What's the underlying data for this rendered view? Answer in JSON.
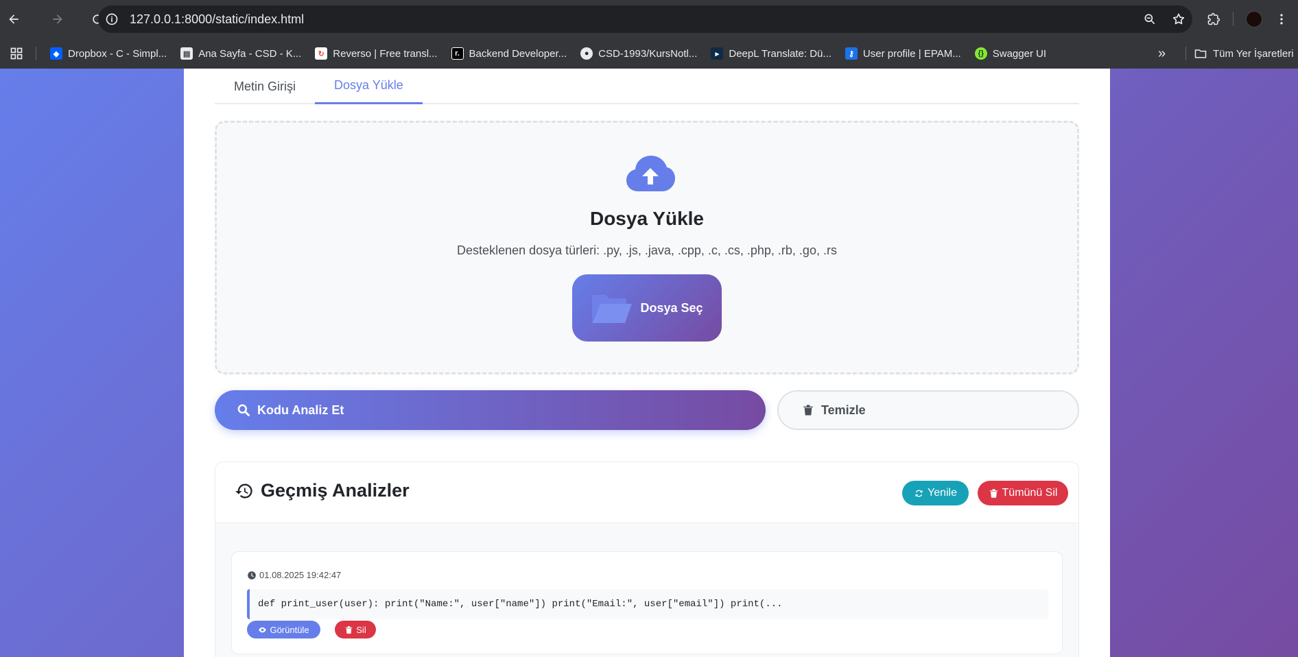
{
  "browser": {
    "url": "127.0.0.1:8000/static/index.html",
    "bookmarks": [
      {
        "label": "Dropbox - C - Simpl...",
        "icon": "dropbox-icon",
        "color": "#0061fe"
      },
      {
        "label": "Ana Sayfa - CSD - K...",
        "icon": "document-icon",
        "color": "#ffffff"
      },
      {
        "label": "Reverso | Free transl...",
        "icon": "reverso-icon",
        "color": "#e94f35"
      },
      {
        "label": "Backend Developer...",
        "icon": "roadmap-icon",
        "color": "#000000"
      },
      {
        "label": "CSD-1993/KursNotl...",
        "icon": "github-icon",
        "color": "#ffffff"
      },
      {
        "label": "DeepL Translate: Dü...",
        "icon": "deepl-icon",
        "color": "#0f2b46"
      },
      {
        "label": "User profile | EPAM...",
        "icon": "key-icon",
        "color": "#1a73e8"
      },
      {
        "label": "Swagger UI",
        "icon": "swagger-icon",
        "color": "#85ea2d"
      }
    ],
    "all_bookmarks_label": "Tüm Yer İşaretleri"
  },
  "tabs": [
    {
      "label": "Metin Girişi",
      "active": false
    },
    {
      "label": "Dosya Yükle",
      "active": true
    }
  ],
  "upload": {
    "title": "Dosya Yükle",
    "supported": "Desteklenen dosya türleri: .py, .js, .java, .cpp, .c, .cs, .php, .rb, .go, .rs",
    "choose_label": "Dosya Seç"
  },
  "actions": {
    "analyze_label": "Kodu Analiz Et",
    "clear_label": "Temizle"
  },
  "history": {
    "title": "Geçmiş Analizler",
    "refresh_label": "Yenile",
    "delete_all_label": "Tümünü Sil",
    "items": [
      {
        "timestamp": "01.08.2025 19:42:47",
        "code_preview": "def print_user(user): print(\"Name:\", user[\"name\"]) print(\"Email:\", user[\"email\"]) print(...",
        "view_label": "Görüntüle",
        "delete_label": "Sil"
      }
    ]
  },
  "colors": {
    "accent": "#667eea",
    "accent_end": "#764ba2",
    "info": "#17a2b8",
    "danger": "#dc3545"
  }
}
